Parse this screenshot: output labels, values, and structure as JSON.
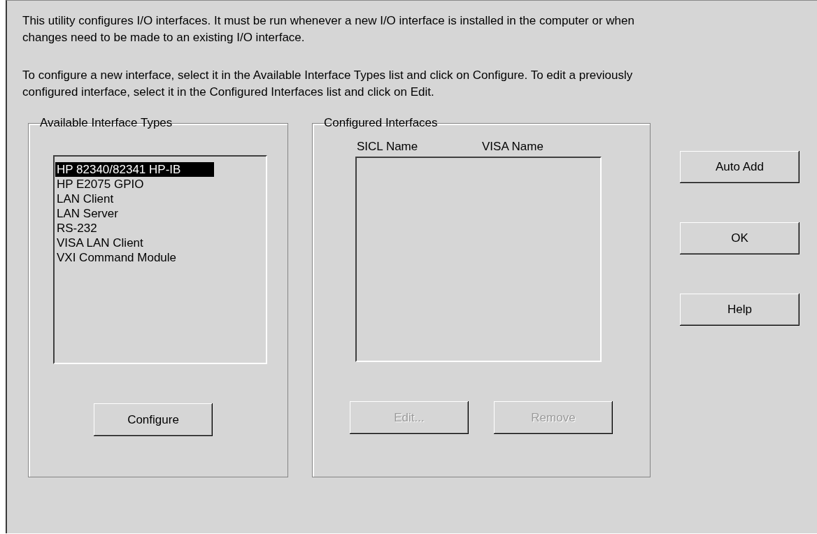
{
  "intro": [
    "This utility configures I/O interfaces.  It must be run whenever a new I/O interface is installed in the computer or when changes need to be made to an existing I/O interface.",
    "To configure a new interface, select it in the Available Interface Types list and click on Configure.  To edit a previously configured interface, select it in the Configured Interfaces list and click on Edit."
  ],
  "available": {
    "title": "Available Interface Types",
    "items": [
      {
        "label": "HP 82340/82341 HP-IB",
        "selected": true
      },
      {
        "label": "HP E2075 GPIO",
        "selected": false
      },
      {
        "label": "LAN Client",
        "selected": false
      },
      {
        "label": "LAN Server",
        "selected": false
      },
      {
        "label": "RS-232",
        "selected": false
      },
      {
        "label": "VISA LAN Client",
        "selected": false
      },
      {
        "label": "VXI Command Module",
        "selected": false
      }
    ],
    "button": {
      "label": "Configure",
      "disabled": false
    }
  },
  "configured": {
    "title": "Configured Interfaces",
    "columns": [
      "SICL Name",
      "VISA Name"
    ],
    "buttons": [
      {
        "label": "Edit...",
        "disabled": true
      },
      {
        "label": "Remove",
        "disabled": true
      }
    ]
  },
  "side_buttons": [
    {
      "label": "Auto Add",
      "disabled": false
    },
    {
      "label": "OK",
      "disabled": false
    },
    {
      "label": "Help",
      "disabled": false
    }
  ]
}
